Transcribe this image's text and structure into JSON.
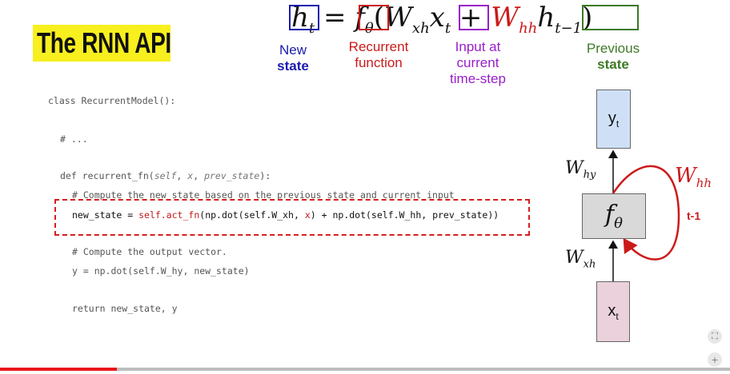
{
  "title": "The RNN API",
  "equation": {
    "lhs": "h",
    "lhs_sub": "t",
    "equals": "=",
    "f": "f",
    "f_sub": "θ",
    "open": "(W",
    "wxh_sub": "xh",
    "x": "x",
    "x_sub": "t",
    "plus": "+",
    "whh": "W",
    "whh_sub": "hh",
    "hprev": "h",
    "hprev_sub": "t−1",
    "close": ")"
  },
  "labels": {
    "new_state_line1": "New",
    "new_state_line2": "state",
    "recurrent_line1": "Recurrent",
    "recurrent_line2": "function",
    "input_line1": "Input at",
    "input_line2": "current",
    "input_line3": "time-step",
    "previous_line1": "Previous",
    "previous_line2": "state"
  },
  "code": {
    "line1": "class RecurrentModel():",
    "line2": "# ...",
    "line3_a": "def recurrent_fn(",
    "line3_self": "self",
    "line3_b": ", ",
    "line3_x": "x",
    "line3_c": ", ",
    "line3_prev": "prev_state",
    "line3_d": "):",
    "line4": "# Compute the new state based on the previous state and current input",
    "line5_a": "new_state = ",
    "line5_b": "self.act_fn",
    "line5_c": "(np.dot(self.W_xh, ",
    "line5_x": "x",
    "line5_d": ") + np.dot(self.W_hh, prev_state))",
    "line6": "# Compute the output vector.",
    "line7": "y = np.dot(self.W_hy, new_state)",
    "line8": "return new_state, y"
  },
  "diagram": {
    "y_node": "y",
    "y_sub": "t",
    "f_node": "f",
    "f_sub": "θ",
    "x_node": "x",
    "x_sub": "t",
    "why": "W",
    "why_sub": "hy",
    "wxh": "W",
    "wxh_sub": "xh",
    "whh": "W",
    "whh_sub": "hh",
    "t_minus_1": "t-1"
  },
  "colors": {
    "title_bg": "#f7ef1e",
    "blue": "#1a1aad",
    "red": "#cc1a1a",
    "purple": "#9a1ec8",
    "green": "#3d7a25",
    "y_node": "#cfe0f6",
    "x_node": "#ead1dc",
    "f_node": "#d9d9d9"
  },
  "player": {
    "progress_fraction": 0.16
  }
}
